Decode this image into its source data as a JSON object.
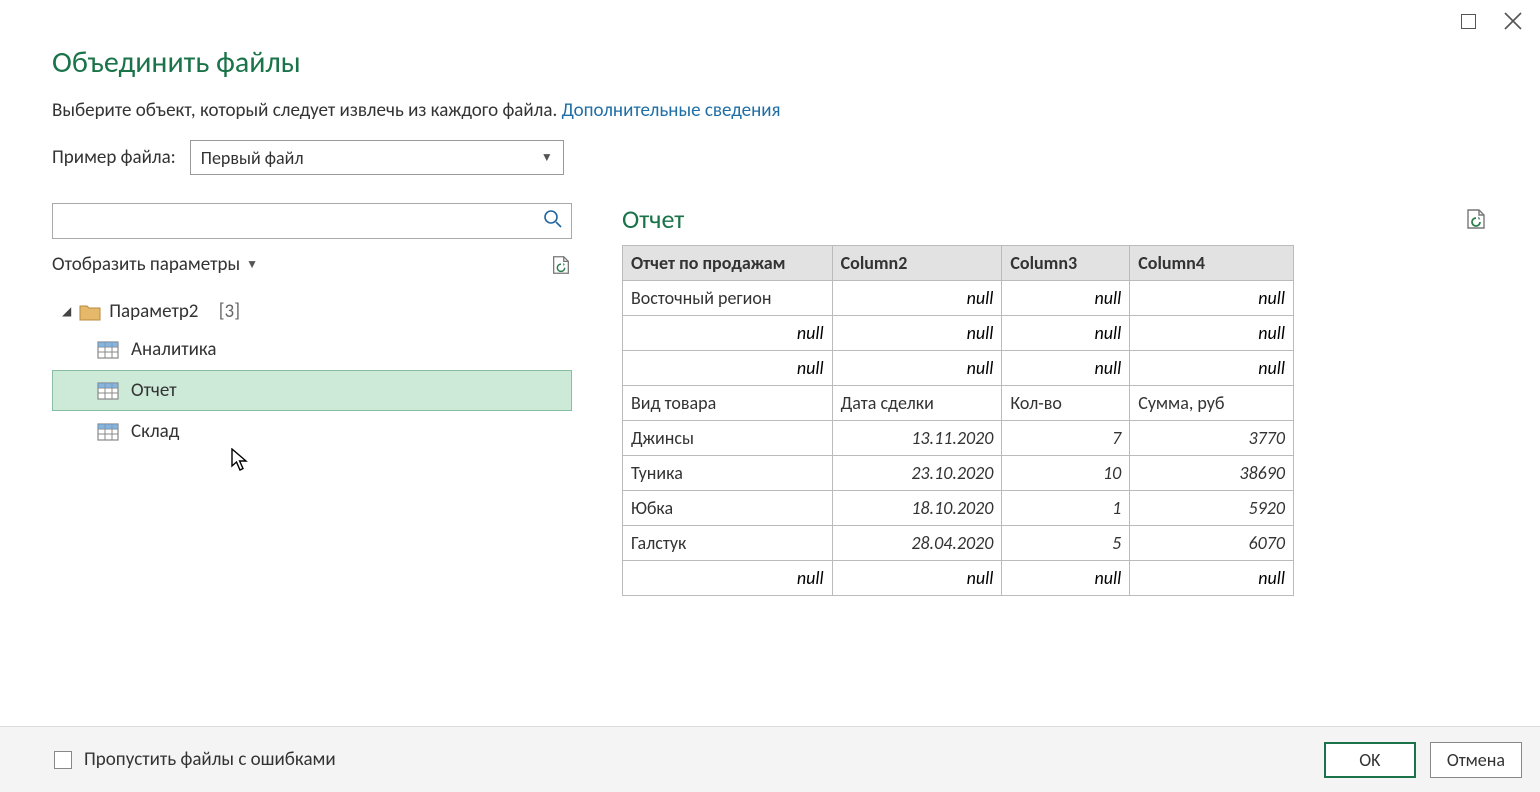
{
  "window": {
    "title": "Объединить файлы",
    "subtitle_text": "Выберите объект, который следует извлечь из каждого файла. ",
    "subtitle_link": "Дополнительные сведения"
  },
  "sample": {
    "label": "Пример файла:",
    "selected": "Первый файл"
  },
  "display_options": "Отобразить параметры",
  "tree": {
    "root": {
      "name": "Параметр2",
      "count_suffix": "[3]"
    },
    "items": [
      {
        "label": "Аналитика",
        "selected": false
      },
      {
        "label": "Отчет",
        "selected": true
      },
      {
        "label": "Склад",
        "selected": false
      }
    ]
  },
  "preview": {
    "title": "Отчет",
    "columns": [
      "Отчет по продажам",
      "Column2",
      "Column3",
      "Column4"
    ],
    "rows": [
      [
        {
          "v": "Восточный регион",
          "type": "text"
        },
        {
          "v": "null",
          "type": "null"
        },
        {
          "v": "null",
          "type": "null"
        },
        {
          "v": "null",
          "type": "null"
        }
      ],
      [
        {
          "v": "null",
          "type": "null"
        },
        {
          "v": "null",
          "type": "null"
        },
        {
          "v": "null",
          "type": "null"
        },
        {
          "v": "null",
          "type": "null"
        }
      ],
      [
        {
          "v": "null",
          "type": "null"
        },
        {
          "v": "null",
          "type": "null"
        },
        {
          "v": "null",
          "type": "null"
        },
        {
          "v": "null",
          "type": "null"
        }
      ],
      [
        {
          "v": "Вид товара",
          "type": "text"
        },
        {
          "v": "Дата сделки",
          "type": "text"
        },
        {
          "v": "Кол-во",
          "type": "text"
        },
        {
          "v": "Сумма, руб",
          "type": "text"
        }
      ],
      [
        {
          "v": "Джинсы",
          "type": "text"
        },
        {
          "v": "13.11.2020",
          "type": "rnum"
        },
        {
          "v": "7",
          "type": "rnum"
        },
        {
          "v": "3770",
          "type": "rnum"
        }
      ],
      [
        {
          "v": "Туника",
          "type": "text"
        },
        {
          "v": "23.10.2020",
          "type": "rnum"
        },
        {
          "v": "10",
          "type": "rnum"
        },
        {
          "v": "38690",
          "type": "rnum"
        }
      ],
      [
        {
          "v": "Юбка",
          "type": "text"
        },
        {
          "v": "18.10.2020",
          "type": "rnum"
        },
        {
          "v": "1",
          "type": "rnum"
        },
        {
          "v": "5920",
          "type": "rnum"
        }
      ],
      [
        {
          "v": "Галстук",
          "type": "text"
        },
        {
          "v": "28.04.2020",
          "type": "rnum"
        },
        {
          "v": "5",
          "type": "rnum"
        },
        {
          "v": "6070",
          "type": "rnum"
        }
      ],
      [
        {
          "v": "null",
          "type": "null"
        },
        {
          "v": "null",
          "type": "null"
        },
        {
          "v": "null",
          "type": "null"
        },
        {
          "v": "null",
          "type": "null"
        }
      ]
    ]
  },
  "footer": {
    "skip_errors": "Пропустить файлы с ошибками",
    "ok": "OK",
    "cancel": "Отмена"
  }
}
